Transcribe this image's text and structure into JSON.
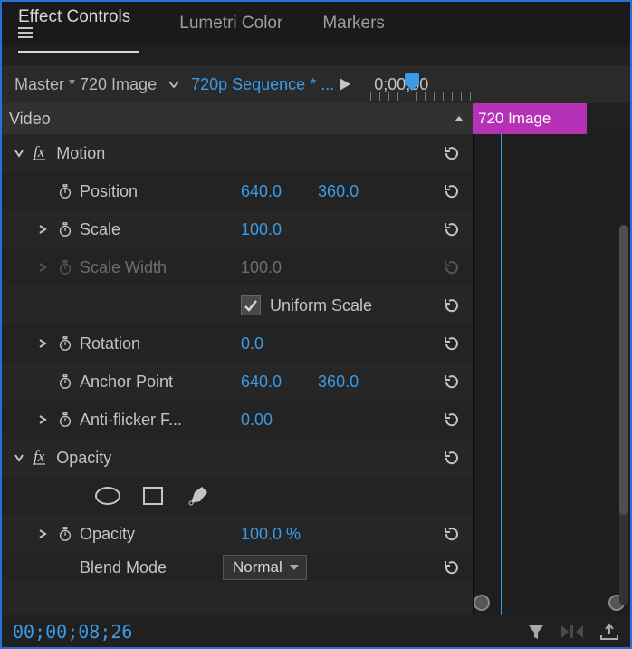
{
  "tabs": {
    "effect_controls": "Effect Controls",
    "lumetri": "Lumetri Color",
    "markers": "Markers"
  },
  "breadcrumb": {
    "master": "Master * 720 Image",
    "sequence": "720p Sequence * ...",
    "mini_timecode": "0;00;00"
  },
  "section": {
    "video_label": "Video",
    "clip_label": "720 Image"
  },
  "motion": {
    "label": "Motion",
    "position_label": "Position",
    "position_x": "640.0",
    "position_y": "360.0",
    "scale_label": "Scale",
    "scale_val": "100.0",
    "scale_width_label": "Scale Width",
    "scale_width_val": "100.0",
    "uniform_label": "Uniform Scale",
    "rotation_label": "Rotation",
    "rotation_val": "0.0",
    "anchor_label": "Anchor Point",
    "anchor_x": "640.0",
    "anchor_y": "360.0",
    "antiflicker_label": "Anti-flicker F...",
    "antiflicker_val": "0.00"
  },
  "opacity": {
    "label": "Opacity",
    "opacity_prop_label": "Opacity",
    "opacity_val": "100.0 %",
    "blend_label": "Blend Mode",
    "blend_val": "Normal"
  },
  "status": {
    "timecode": "00;00;08;26"
  }
}
